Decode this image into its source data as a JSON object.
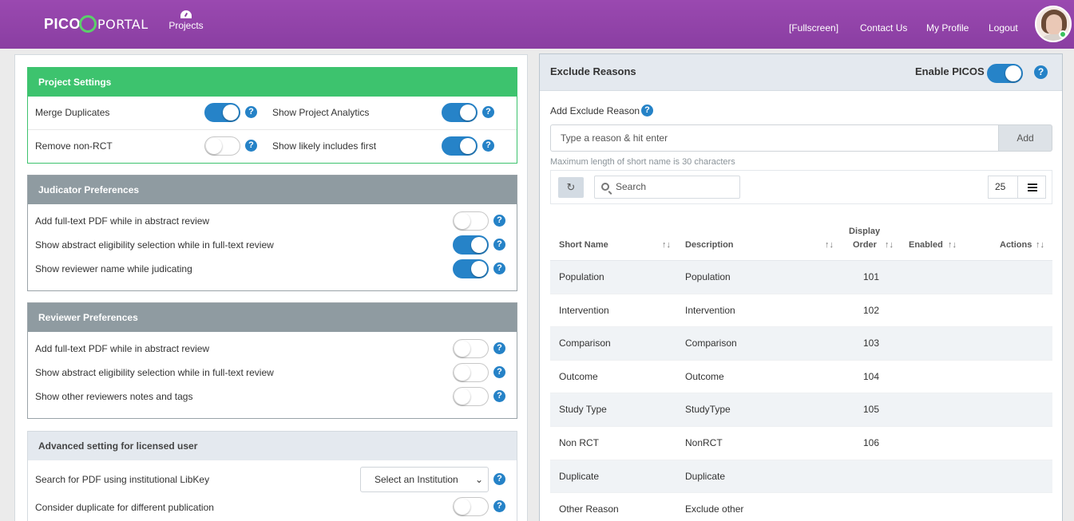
{
  "header": {
    "logo_pico": "PICO",
    "logo_portal": "PORTAL",
    "nav_projects": "Projects",
    "nav_fullscreen": "[Fullscreen]",
    "nav_contact": "Contact Us",
    "nav_profile": "My Profile",
    "nav_logout": "Logout"
  },
  "project_settings": {
    "title": "Project Settings",
    "merge_duplicates": "Merge Duplicates",
    "show_analytics": "Show Project Analytics",
    "remove_non_rct": "Remove non-RCT",
    "show_likely": "Show likely includes first"
  },
  "judicator": {
    "title": "Judicator Preferences",
    "items": [
      {
        "label": "Add full-text PDF while in abstract review",
        "on": false
      },
      {
        "label": "Show abstract eligibility selection while in full-text review",
        "on": true
      },
      {
        "label": "Show reviewer name while judicating",
        "on": true
      }
    ]
  },
  "reviewer": {
    "title": "Reviewer Preferences",
    "items": [
      {
        "label": "Add full-text PDF while in abstract review",
        "on": false
      },
      {
        "label": "Show abstract eligibility selection while in full-text review",
        "on": false
      },
      {
        "label": "Show other reviewers notes and tags",
        "on": false
      }
    ]
  },
  "advanced": {
    "title": "Advanced setting for licensed user",
    "libkey_label": "Search for PDF using institutional LibKey",
    "institution_select": "Select an Institution",
    "duplicate_label": "Consider duplicate for different publication"
  },
  "exclude": {
    "title": "Exclude Reasons",
    "enable_picos": "Enable PICOS",
    "add_label": "Add Exclude Reason",
    "input_placeholder": "Type a reason & hit enter",
    "add_button": "Add",
    "max_note": "Maximum length of short name is 30 characters",
    "search_placeholder": "Search",
    "page_size": "25",
    "columns": {
      "short_name": "Short Name",
      "description": "Description",
      "display_order_1": "Display",
      "display_order_2": "Order",
      "enabled": "Enabled",
      "actions": "Actions"
    },
    "rows": [
      {
        "short": "Population",
        "desc": "Population",
        "order": "101"
      },
      {
        "short": "Intervention",
        "desc": "Intervention",
        "order": "102"
      },
      {
        "short": "Comparison",
        "desc": "Comparison",
        "order": "103"
      },
      {
        "short": "Outcome",
        "desc": "Outcome",
        "order": "104"
      },
      {
        "short": "Study Type",
        "desc": "StudyType",
        "order": "105"
      },
      {
        "short": "Non RCT",
        "desc": "NonRCT",
        "order": "106"
      },
      {
        "short": "Duplicate",
        "desc": "Duplicate",
        "order": ""
      },
      {
        "short": "Other Reason",
        "desc": "Exclude other",
        "order": ""
      }
    ]
  },
  "icons": {
    "help": "?",
    "sort": "↑↓",
    "chevron": "⌄",
    "refresh": "↻"
  },
  "colors": {
    "header_purple": "#8f42a6",
    "green": "#3dc36e",
    "toggle_blue": "#2683c8"
  }
}
